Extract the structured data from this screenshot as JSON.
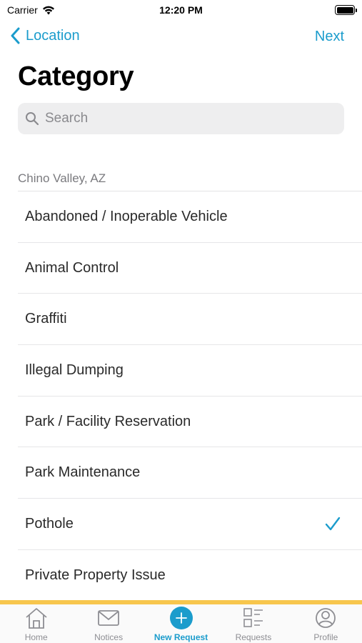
{
  "status_bar": {
    "carrier": "Carrier",
    "time": "12:20 PM"
  },
  "nav": {
    "back_label": "Location",
    "next_label": "Next"
  },
  "page": {
    "title": "Category"
  },
  "search": {
    "placeholder": "Search",
    "value": ""
  },
  "section": {
    "header": "Chino Valley, AZ"
  },
  "categories": [
    {
      "label": "Abandoned / Inoperable Vehicle",
      "selected": false
    },
    {
      "label": "Animal Control",
      "selected": false
    },
    {
      "label": "Graffiti",
      "selected": false
    },
    {
      "label": "Illegal Dumping",
      "selected": false
    },
    {
      "label": "Park / Facility Reservation",
      "selected": false
    },
    {
      "label": "Park Maintenance",
      "selected": false
    },
    {
      "label": "Pothole",
      "selected": true
    },
    {
      "label": "Private Property Issue",
      "selected": false
    }
  ],
  "tab_bar": {
    "active": "New Request",
    "tabs": [
      {
        "label": "Home",
        "icon": "home-icon"
      },
      {
        "label": "Notices",
        "icon": "envelope-icon"
      },
      {
        "label": "New Request",
        "icon": "plus-circle-icon"
      },
      {
        "label": "Requests",
        "icon": "list-icon"
      },
      {
        "label": "Profile",
        "icon": "person-icon"
      }
    ]
  },
  "colors": {
    "accent": "#1b9ccc",
    "tab_accent_bar": "#f7c64d",
    "inactive_tab": "#8e8e93"
  }
}
